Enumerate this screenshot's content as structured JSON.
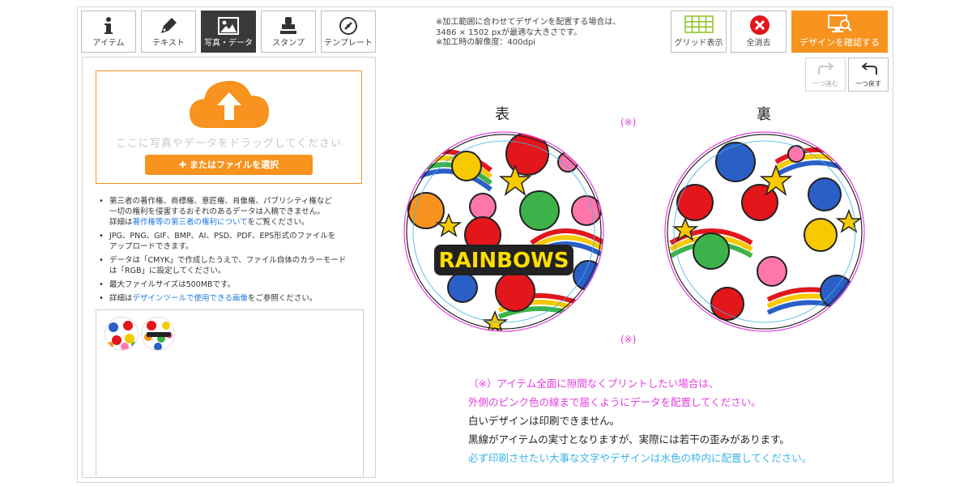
{
  "tabs": [
    {
      "label": "アイテム",
      "icon": "info-icon",
      "active": false
    },
    {
      "label": "テキスト",
      "icon": "pen-icon",
      "active": false
    },
    {
      "label": "写真・データ",
      "icon": "image-icon",
      "active": true
    },
    {
      "label": "スタンプ",
      "icon": "stamp-icon",
      "active": false
    },
    {
      "label": "テンプレート",
      "icon": "template-icon",
      "active": false
    }
  ],
  "notes": {
    "line1": "※加工範囲に合わせてデザインを配置する場合は、",
    "line2": "3486 × 1502 pxが最適な大きさです。",
    "line3": "※加工時の解像度：400dpi"
  },
  "toolbar": {
    "grid_label": "グリッド表示",
    "clear_label": "全消去",
    "confirm_label": "デザインを確認する",
    "redo_label": "一つ進む",
    "undo_label": "一つ戻す"
  },
  "upload": {
    "drop_text": "ここに写真やデータをドラッグしてください",
    "file_button": "またはファイルを選択"
  },
  "info": {
    "item1_line1": "第三者の著作権、商標権、意匠権、肖像権、パブリシティ権など",
    "item1_line2": "一切の権利を侵害するおそれのあるデータは入稿できません。",
    "item1_pre": "詳細は",
    "item1_link": "著作権等の第三者の権利について",
    "item1_post": "をご覧ください。",
    "item2_line1": "JPG、PNG、GIF、BMP、AI、PSD、PDF、EPS形式のファイルを",
    "item2_line2": "アップロードできます。",
    "item3_line1": "データは「CMYK」で作成したうえで、ファイル自体のカラーモード",
    "item3_line2": "は「RGB」に設定してください。",
    "item4": "最大ファイルサイズは500MBです。",
    "item5_pre": "詳細は",
    "item5_link": "デザインツールで使用できる画像",
    "item5_post": "をご参照ください。"
  },
  "canvas": {
    "front_label": "表",
    "back_label": "裏",
    "mark_top": "(※)",
    "mark_bottom": "(※)",
    "front_text": "RAINBOWS"
  },
  "bottom_notes": {
    "line1": "（※）アイテム全面に隙間なくプリントしたい場合は、",
    "line2": "外側のピンク色の線まで届くようにデータを配置してください。",
    "line3": "白いデザインは印刷できません。",
    "line4": "黒線がアイテムの実寸となりますが、実際には若干の歪みがあります。",
    "line5": "必ず印刷させたい大事な文字やデザインは水色の枠内に配置してください。"
  },
  "colors": {
    "accent": "#f7931e",
    "pink_guide": "#e43fe0",
    "cyan_guide": "#3ab5e8",
    "active_tab": "#3a3a3a"
  }
}
